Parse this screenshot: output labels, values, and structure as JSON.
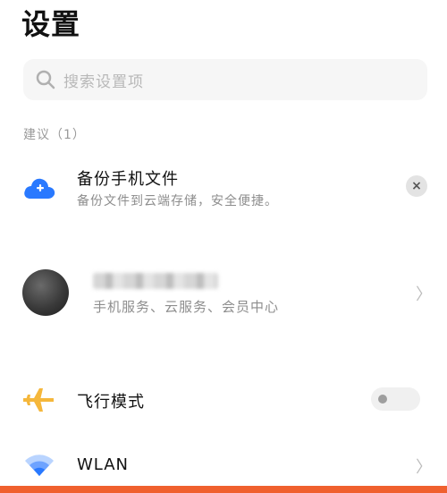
{
  "header": {
    "title": "设置"
  },
  "search": {
    "placeholder": "搜索设置项"
  },
  "suggestions": {
    "section_label": "建议（1）",
    "backup": {
      "title": "备份手机文件",
      "subtitle": "备份文件到云端存储，安全便捷。",
      "icon": "cloud-plus-icon",
      "dismiss": "×"
    }
  },
  "account": {
    "subtitle": "手机服务、云服务、会员中心",
    "icon": "avatar"
  },
  "settings": {
    "airplane": {
      "label": "飞行模式",
      "icon": "airplane-icon",
      "enabled": false
    },
    "wlan": {
      "label": "WLAN",
      "icon": "wifi-icon"
    }
  },
  "colors": {
    "accent": "#2979ff",
    "airplane": "#f5b73b",
    "bottom_bar": "#f0602e"
  }
}
